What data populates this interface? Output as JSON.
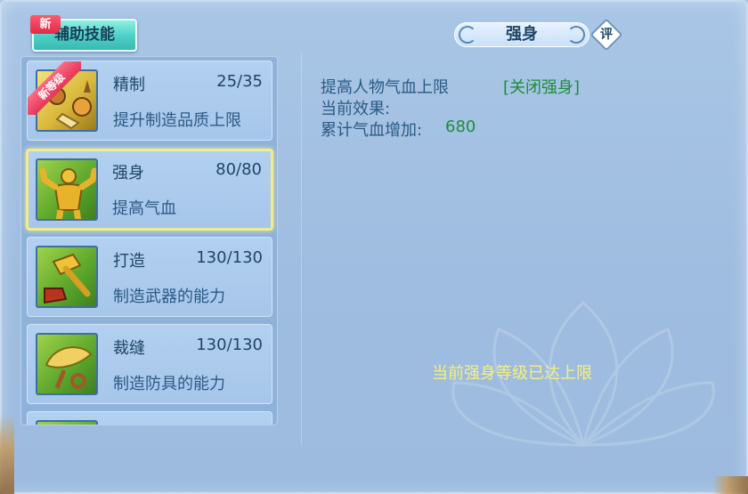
{
  "tab": {
    "label": "辅助技能",
    "new_badge": "新"
  },
  "skills": [
    {
      "name": "精制",
      "level": "25/35",
      "desc": "提升制造品质上限",
      "ribbon": "新等级"
    },
    {
      "name": "强身",
      "level": "80/80",
      "desc": "提高气血"
    },
    {
      "name": "打造",
      "level": "130/130",
      "desc": "制造武器的能力"
    },
    {
      "name": "裁缝",
      "level": "130/130",
      "desc": "制造防具的能力"
    }
  ],
  "detail": {
    "title": "强身",
    "rate_label": "评",
    "effect_line": "提高人物气血上限",
    "toggle_link": "[关闭强身]",
    "current_effect_label": "当前效果:",
    "accum_label": "累计气血增加:",
    "accum_value": "680",
    "max_message": "当前强身等级已达上限"
  },
  "colors": {
    "accent_green": "#1c8c3a",
    "highlight_yellow": "#f7f07a",
    "selected_border": "#f4ec8a"
  }
}
